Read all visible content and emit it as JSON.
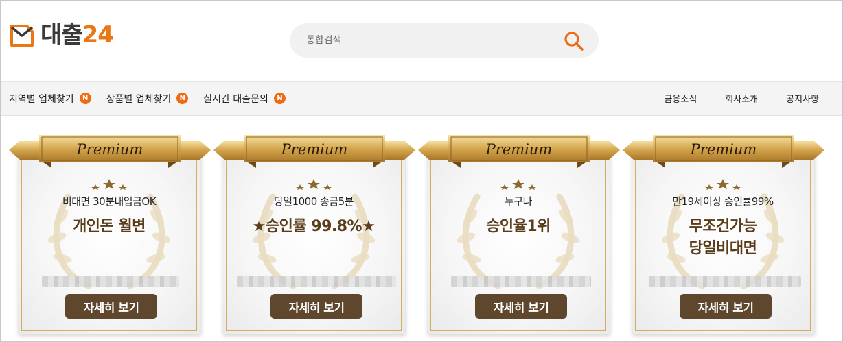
{
  "logo": {
    "text_kr": "대출",
    "text_num": "24",
    "mark_icon": "logo-envelope-icon",
    "brand_color": "#ea7714"
  },
  "search": {
    "placeholder": "통합검색",
    "value": "",
    "icon": "search-icon",
    "icon_color": "#ee6b13"
  },
  "nav": {
    "left_items": [
      {
        "label": "지역별 업체찾기",
        "badge": "N"
      },
      {
        "label": "상품별 업체찾기",
        "badge": "N"
      },
      {
        "label": "실시간 대출문의",
        "badge": "N"
      }
    ],
    "right_items": [
      {
        "label": "금융소식"
      },
      {
        "label": "회사소개"
      },
      {
        "label": "공지사항"
      }
    ],
    "badge_color": "#ee6b13"
  },
  "cards": [
    {
      "ribbon": "Premium",
      "line1": "비대면 30분내입금OK",
      "line2a": "개인돈 월변",
      "line2b": "",
      "button": "자세히 보기"
    },
    {
      "ribbon": "Premium",
      "line1": "당일1000 송금5분",
      "line2a": "★승인률 99.8%★",
      "line2b": "",
      "button": "자세히 보기"
    },
    {
      "ribbon": "Premium",
      "line1": "누구나",
      "line2a": "승인율1위",
      "line2b": "",
      "button": "자세히 보기"
    },
    {
      "ribbon": "Premium",
      "line1": "만19세이상 승인률99%",
      "line2a": "무조건가능",
      "line2b": "당일비대면",
      "button": "자세히 보기"
    }
  ],
  "colors": {
    "gold": "#c99a44",
    "button_brown": "#5e472d",
    "title_brown": "#5a3d1a"
  }
}
